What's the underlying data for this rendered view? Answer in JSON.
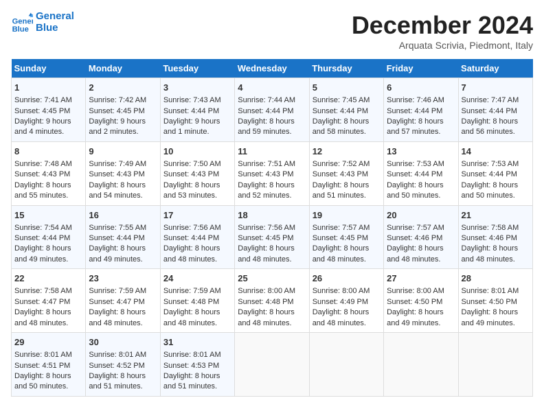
{
  "header": {
    "logo_line1": "General",
    "logo_line2": "Blue",
    "month": "December 2024",
    "location": "Arquata Scrivia, Piedmont, Italy"
  },
  "days_of_week": [
    "Sunday",
    "Monday",
    "Tuesday",
    "Wednesday",
    "Thursday",
    "Friday",
    "Saturday"
  ],
  "weeks": [
    [
      {
        "day": "1",
        "rise": "7:41 AM",
        "set": "4:45 PM",
        "daylight": "9 hours and 4 minutes."
      },
      {
        "day": "2",
        "rise": "7:42 AM",
        "set": "4:45 PM",
        "daylight": "9 hours and 2 minutes."
      },
      {
        "day": "3",
        "rise": "7:43 AM",
        "set": "4:44 PM",
        "daylight": "9 hours and 1 minute."
      },
      {
        "day": "4",
        "rise": "7:44 AM",
        "set": "4:44 PM",
        "daylight": "8 hours and 59 minutes."
      },
      {
        "day": "5",
        "rise": "7:45 AM",
        "set": "4:44 PM",
        "daylight": "8 hours and 58 minutes."
      },
      {
        "day": "6",
        "rise": "7:46 AM",
        "set": "4:44 PM",
        "daylight": "8 hours and 57 minutes."
      },
      {
        "day": "7",
        "rise": "7:47 AM",
        "set": "4:44 PM",
        "daylight": "8 hours and 56 minutes."
      }
    ],
    [
      {
        "day": "8",
        "rise": "7:48 AM",
        "set": "4:43 PM",
        "daylight": "8 hours and 55 minutes."
      },
      {
        "day": "9",
        "rise": "7:49 AM",
        "set": "4:43 PM",
        "daylight": "8 hours and 54 minutes."
      },
      {
        "day": "10",
        "rise": "7:50 AM",
        "set": "4:43 PM",
        "daylight": "8 hours and 53 minutes."
      },
      {
        "day": "11",
        "rise": "7:51 AM",
        "set": "4:43 PM",
        "daylight": "8 hours and 52 minutes."
      },
      {
        "day": "12",
        "rise": "7:52 AM",
        "set": "4:43 PM",
        "daylight": "8 hours and 51 minutes."
      },
      {
        "day": "13",
        "rise": "7:53 AM",
        "set": "4:44 PM",
        "daylight": "8 hours and 50 minutes."
      },
      {
        "day": "14",
        "rise": "7:53 AM",
        "set": "4:44 PM",
        "daylight": "8 hours and 50 minutes."
      }
    ],
    [
      {
        "day": "15",
        "rise": "7:54 AM",
        "set": "4:44 PM",
        "daylight": "8 hours and 49 minutes."
      },
      {
        "day": "16",
        "rise": "7:55 AM",
        "set": "4:44 PM",
        "daylight": "8 hours and 49 minutes."
      },
      {
        "day": "17",
        "rise": "7:56 AM",
        "set": "4:44 PM",
        "daylight": "8 hours and 48 minutes."
      },
      {
        "day": "18",
        "rise": "7:56 AM",
        "set": "4:45 PM",
        "daylight": "8 hours and 48 minutes."
      },
      {
        "day": "19",
        "rise": "7:57 AM",
        "set": "4:45 PM",
        "daylight": "8 hours and 48 minutes."
      },
      {
        "day": "20",
        "rise": "7:57 AM",
        "set": "4:46 PM",
        "daylight": "8 hours and 48 minutes."
      },
      {
        "day": "21",
        "rise": "7:58 AM",
        "set": "4:46 PM",
        "daylight": "8 hours and 48 minutes."
      }
    ],
    [
      {
        "day": "22",
        "rise": "7:58 AM",
        "set": "4:47 PM",
        "daylight": "8 hours and 48 minutes."
      },
      {
        "day": "23",
        "rise": "7:59 AM",
        "set": "4:47 PM",
        "daylight": "8 hours and 48 minutes."
      },
      {
        "day": "24",
        "rise": "7:59 AM",
        "set": "4:48 PM",
        "daylight": "8 hours and 48 minutes."
      },
      {
        "day": "25",
        "rise": "8:00 AM",
        "set": "4:48 PM",
        "daylight": "8 hours and 48 minutes."
      },
      {
        "day": "26",
        "rise": "8:00 AM",
        "set": "4:49 PM",
        "daylight": "8 hours and 48 minutes."
      },
      {
        "day": "27",
        "rise": "8:00 AM",
        "set": "4:50 PM",
        "daylight": "8 hours and 49 minutes."
      },
      {
        "day": "28",
        "rise": "8:01 AM",
        "set": "4:50 PM",
        "daylight": "8 hours and 49 minutes."
      }
    ],
    [
      {
        "day": "29",
        "rise": "8:01 AM",
        "set": "4:51 PM",
        "daylight": "8 hours and 50 minutes."
      },
      {
        "day": "30",
        "rise": "8:01 AM",
        "set": "4:52 PM",
        "daylight": "8 hours and 51 minutes."
      },
      {
        "day": "31",
        "rise": "8:01 AM",
        "set": "4:53 PM",
        "daylight": "8 hours and 51 minutes."
      },
      null,
      null,
      null,
      null
    ]
  ],
  "labels": {
    "sunrise": "Sunrise:",
    "sunset": "Sunset:",
    "daylight": "Daylight:"
  }
}
